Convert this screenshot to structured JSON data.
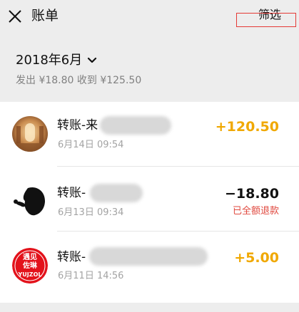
{
  "header": {
    "title": "账单",
    "filter_label": "筛选",
    "close_icon": "close-icon"
  },
  "period": {
    "month": "2018年6月",
    "summary": "发出 ¥18.80 收到 ¥125.50"
  },
  "transactions": [
    {
      "name": "转账-来",
      "datetime": "6月14日 09:54",
      "amount": "+120.50",
      "status": "",
      "avatar_icon": "room-photo-avatar",
      "amount_color": "#f0a800"
    },
    {
      "name": "转账-",
      "datetime": "6月13日 09:34",
      "amount": "−18.80",
      "status": "已全额退款",
      "avatar_icon": "silhouette-avatar",
      "amount_color": "#111111"
    },
    {
      "name": "转账-",
      "datetime": "6月11日 14:56",
      "amount": "+5.00",
      "status": "",
      "avatar_icon": "red-badge-avatar",
      "avatar_text_top": "遇见",
      "avatar_text_mid": "佐琳",
      "avatar_text_bottom": "YUJZOL",
      "amount_color": "#f0a800"
    }
  ]
}
